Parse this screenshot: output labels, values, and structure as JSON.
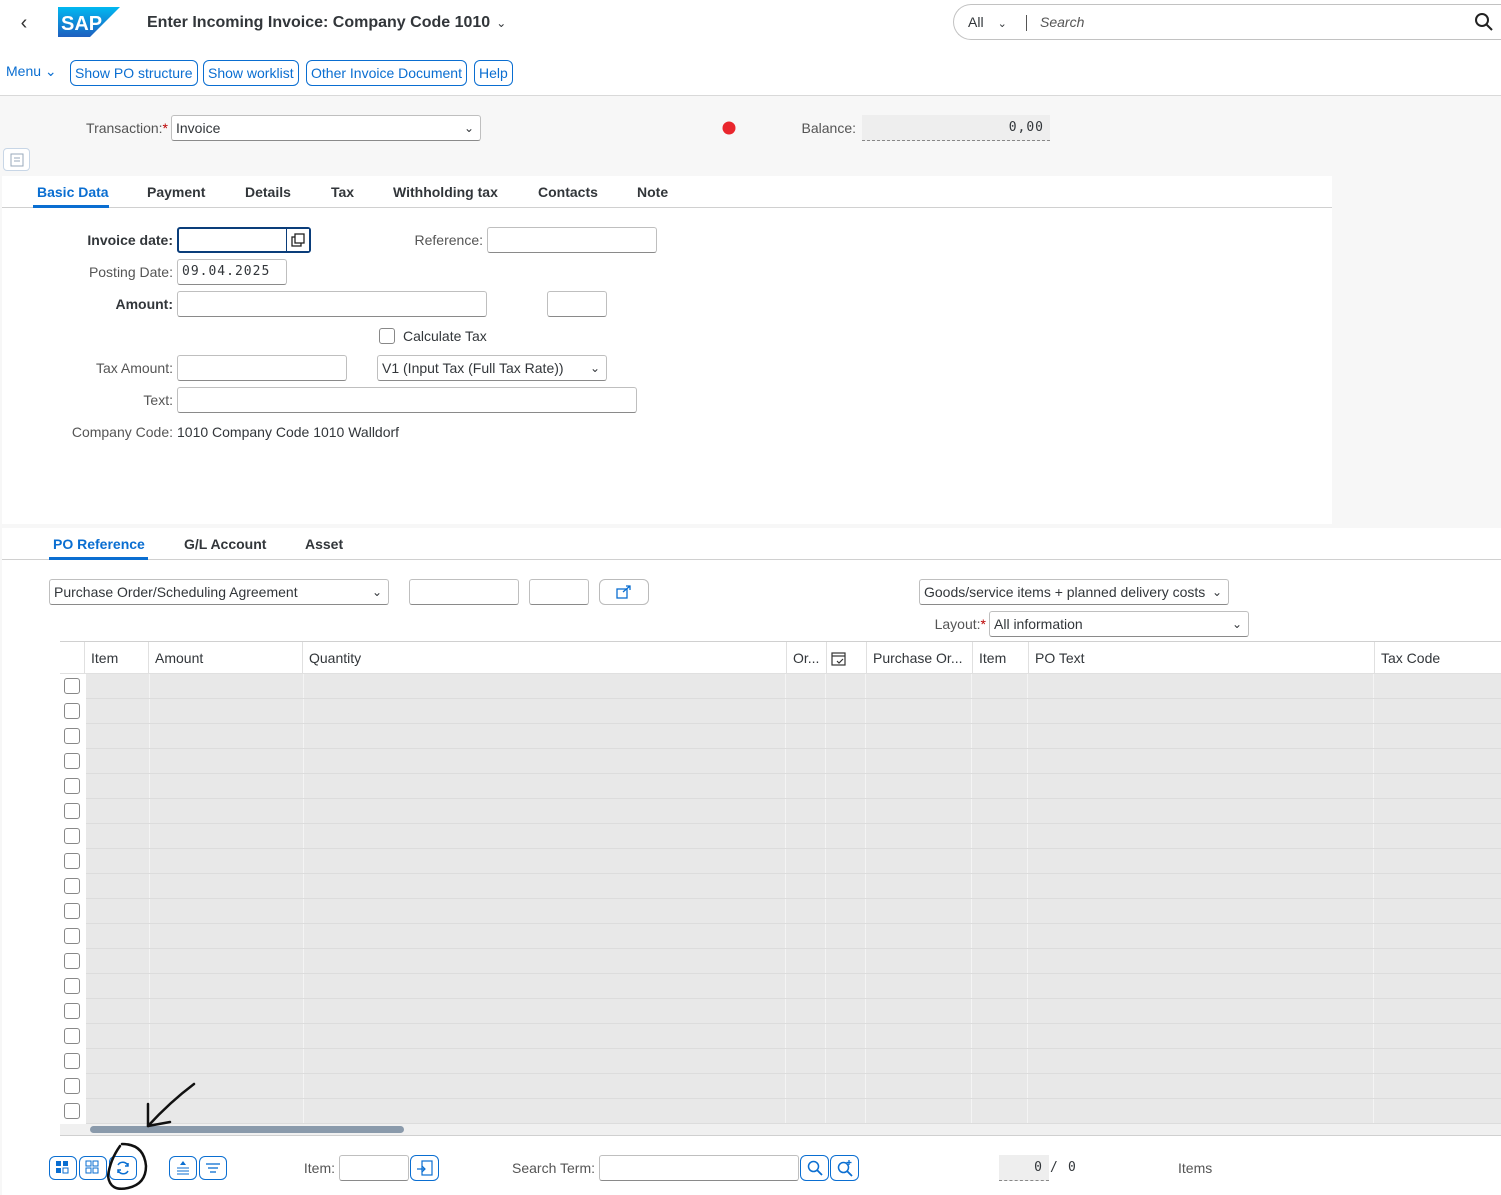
{
  "shell": {
    "logo_text": "SAP",
    "title": "Enter Incoming Invoice: Company Code 1010",
    "search_scope": "All",
    "search_placeholder": "Search"
  },
  "toolbar": {
    "menu_label": "Menu",
    "buttons": [
      "Show PO structure",
      "Show worklist",
      "Other Invoice Document",
      "Help"
    ]
  },
  "header": {
    "transaction_label": "Transaction:",
    "transaction_value": "Invoice",
    "balance_label": "Balance:",
    "balance_value": "0,00",
    "status_color": "#e9262d"
  },
  "top_tabs": [
    "Basic Data",
    "Payment",
    "Details",
    "Tax",
    "Withholding tax",
    "Contacts",
    "Note"
  ],
  "basic_data": {
    "invoice_date_label": "Invoice date:",
    "invoice_date_value": "",
    "reference_label": "Reference:",
    "posting_date_label": "Posting Date:",
    "posting_date_value": "09.04.2025",
    "amount_label": "Amount:",
    "calculate_tax_label": "Calculate Tax",
    "tax_amount_label": "Tax Amount:",
    "tax_code_value": "V1 (Input Tax (Full Tax Rate))",
    "text_label": "Text:",
    "company_code_label": "Company Code:",
    "company_code_value": "1010 Company Code 1010 Walldorf"
  },
  "bottom_tabs": [
    "PO Reference",
    "G/L Account",
    "Asset"
  ],
  "po_reference": {
    "doc_type_value": "Purchase Order/Scheduling Agreement",
    "items_filter_value": "Goods/service items + planned delivery costs",
    "layout_label": "Layout:",
    "layout_value": "All information"
  },
  "grid": {
    "columns": [
      "Item",
      "Amount",
      "Quantity",
      "Or...",
      "",
      "Purchase Or...",
      "Item",
      "PO Text",
      "Tax Code"
    ],
    "row_count": 18
  },
  "footer": {
    "item_label": "Item:",
    "search_term_label": "Search Term:",
    "count_current": "0",
    "count_sep": "/",
    "count_total": "0",
    "items_label": "Items"
  },
  "colors": {
    "accent": "#0a6ed1",
    "required": "#bb0000"
  }
}
